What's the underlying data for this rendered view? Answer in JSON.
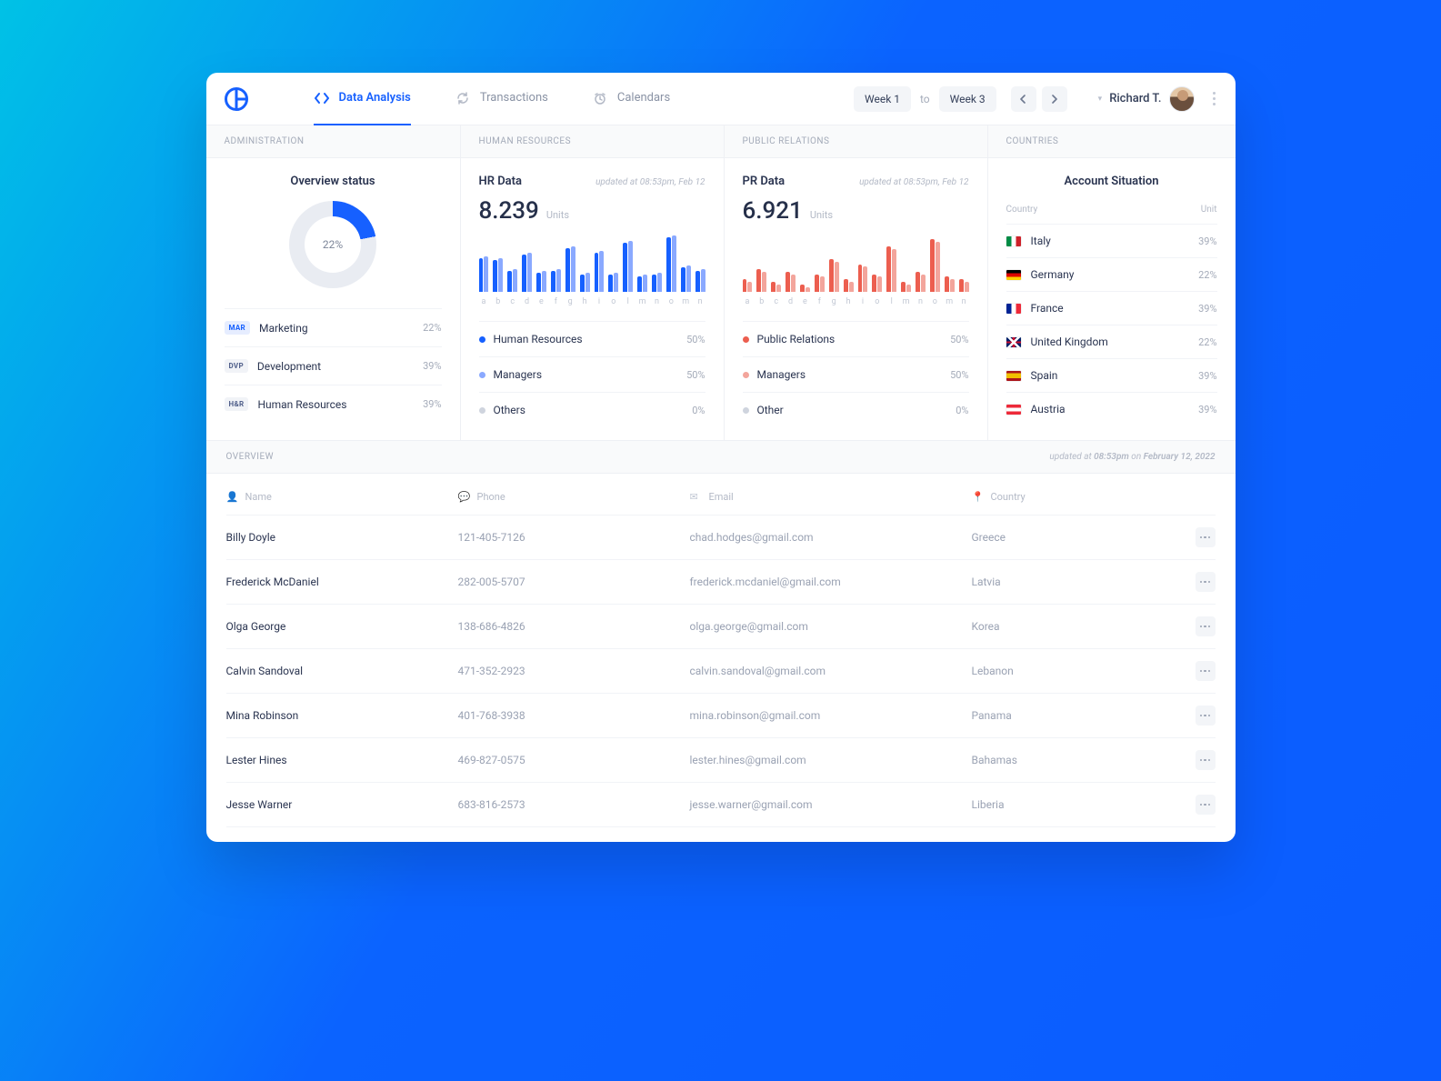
{
  "nav": {
    "tabs": [
      {
        "label": "Data Analysis",
        "active": true
      },
      {
        "label": "Transactions",
        "active": false
      },
      {
        "label": "Calendars",
        "active": false
      }
    ],
    "week_from": "Week 1",
    "to": "to",
    "week_to": "Week 3",
    "user_name": "Richard T."
  },
  "columns_headers": {
    "admin": "ADMINISTRATION",
    "hr": "HUMAN RESOURCES",
    "pr": "PUBLIC RELATIONS",
    "countries": "COUNTRIES"
  },
  "admin": {
    "title": "Overview status",
    "donut_pct": "22%",
    "rows": [
      {
        "badge": "MAR",
        "label": "Marketing",
        "pct": "22%"
      },
      {
        "badge": "DVP",
        "label": "Development",
        "pct": "39%"
      },
      {
        "badge": "H&R",
        "label": "Human Resources",
        "pct": "39%"
      }
    ]
  },
  "hr": {
    "title": "HR Data",
    "timestamp": "updated at 08:53pm, Feb 12",
    "value": "8.239",
    "unit": "Units",
    "legend": [
      {
        "label": "Human Resources",
        "pct": "50%",
        "color": "#1660ff"
      },
      {
        "label": "Managers",
        "pct": "50%",
        "color": "#8aa9ff"
      },
      {
        "label": "Others",
        "pct": "0%",
        "color": "#cfd4de"
      }
    ]
  },
  "pr": {
    "title": "PR Data",
    "timestamp": "updated at 08:53pm, Feb 12",
    "value": "6.921",
    "unit": "Units",
    "legend": [
      {
        "label": "Public Relations",
        "pct": "50%",
        "color": "#ec5e4f"
      },
      {
        "label": "Managers",
        "pct": "50%",
        "color": "#f3a59c"
      },
      {
        "label": "Other",
        "pct": "0%",
        "color": "#cfd4de"
      }
    ]
  },
  "countries_panel": {
    "title": "Account Situation",
    "head_left": "Country",
    "head_right": "Unit",
    "rows": [
      {
        "name": "Italy",
        "pct": "39%"
      },
      {
        "name": "Germany",
        "pct": "22%"
      },
      {
        "name": "France",
        "pct": "39%"
      },
      {
        "name": "United Kingdom",
        "pct": "22%"
      },
      {
        "name": "Spain",
        "pct": "39%"
      },
      {
        "name": "Austria",
        "pct": "39%"
      }
    ]
  },
  "overview": {
    "head": "OVERVIEW",
    "updated_prefix": "updated at ",
    "updated_time": "08:53pm",
    "updated_mid": " on ",
    "updated_date": "February 12, 2022",
    "columns": {
      "name": "Name",
      "phone": "Phone",
      "email": "Email",
      "country": "Country"
    },
    "rows": [
      {
        "name": "Billy Doyle",
        "phone": "121-405-7126",
        "email": "chad.hodges@gmail.com",
        "country": "Greece"
      },
      {
        "name": "Frederick McDaniel",
        "phone": "282-005-5707",
        "email": "frederick.mcdaniel@gmail.com",
        "country": "Latvia"
      },
      {
        "name": "Olga George",
        "phone": "138-686-4826",
        "email": "olga.george@gmail.com",
        "country": "Korea"
      },
      {
        "name": "Calvin Sandoval",
        "phone": "471-352-2923",
        "email": "calvin.sandoval@gmail.com",
        "country": "Lebanon"
      },
      {
        "name": "Mina Robinson",
        "phone": "401-768-3938",
        "email": "mina.robinson@gmail.com",
        "country": "Panama"
      },
      {
        "name": "Lester Hines",
        "phone": "469-827-0575",
        "email": "lester.hines@gmail.com",
        "country": "Bahamas"
      },
      {
        "name": "Jesse Warner",
        "phone": "683-816-2573",
        "email": "jesse.warner@gmail.com",
        "country": "Liberia"
      }
    ]
  },
  "chart_data": [
    {
      "type": "pie",
      "title": "Overview status",
      "series": [
        {
          "name": "highlighted",
          "values": [
            22
          ]
        },
        {
          "name": "remainder",
          "values": [
            78
          ]
        }
      ],
      "colors": [
        "#1660ff",
        "#e9ecf2"
      ]
    },
    {
      "type": "bar",
      "title": "HR Data",
      "categories": [
        "a",
        "b",
        "c",
        "d",
        "e",
        "f",
        "g",
        "h",
        "i",
        "o",
        "l",
        "m",
        "n",
        "o",
        "m",
        "n"
      ],
      "series": [
        {
          "name": "Human Resources",
          "color": "#1660ff",
          "values": [
            36,
            34,
            22,
            40,
            20,
            22,
            46,
            18,
            42,
            18,
            52,
            16,
            18,
            58,
            26,
            22
          ]
        },
        {
          "name": "Managers",
          "color": "#8aa9ff",
          "values": [
            38,
            36,
            24,
            42,
            22,
            24,
            48,
            20,
            44,
            20,
            54,
            18,
            20,
            60,
            28,
            24
          ]
        }
      ],
      "ylim": [
        0,
        60
      ],
      "ylabel": "Units"
    },
    {
      "type": "bar",
      "title": "PR Data",
      "categories": [
        "a",
        "b",
        "c",
        "d",
        "e",
        "f",
        "g",
        "h",
        "i",
        "o",
        "l",
        "m",
        "n",
        "o",
        "m",
        "n"
      ],
      "series": [
        {
          "name": "Public Relations",
          "color": "#ec5e4f",
          "values": [
            10,
            18,
            8,
            16,
            6,
            14,
            26,
            10,
            22,
            14,
            36,
            8,
            16,
            42,
            12,
            10
          ]
        },
        {
          "name": "Managers",
          "color": "#f3a59c",
          "values": [
            8,
            16,
            6,
            14,
            4,
            12,
            24,
            8,
            20,
            12,
            34,
            6,
            14,
            40,
            10,
            8
          ]
        }
      ],
      "ylim": [
        0,
        45
      ],
      "ylabel": "Units"
    }
  ]
}
